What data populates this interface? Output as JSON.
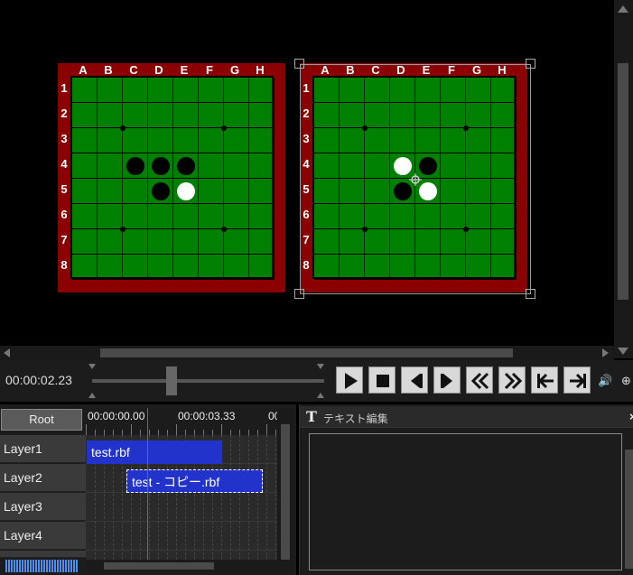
{
  "stage": {
    "column_labels": [
      "A",
      "B",
      "C",
      "D",
      "E",
      "F",
      "G",
      "H"
    ],
    "row_labels": [
      "1",
      "2",
      "3",
      "4",
      "5",
      "6",
      "7",
      "8"
    ],
    "colors": {
      "board_frame": "#8b0000",
      "board_green": "#008000"
    },
    "board_left": {
      "stones": [
        {
          "col": "C",
          "row": "4",
          "color": "black"
        },
        {
          "col": "D",
          "row": "4",
          "color": "black"
        },
        {
          "col": "E",
          "row": "4",
          "color": "black"
        },
        {
          "col": "D",
          "row": "5",
          "color": "black"
        },
        {
          "col": "E",
          "row": "5",
          "color": "white"
        }
      ]
    },
    "board_right": {
      "selected": true,
      "stones": [
        {
          "col": "D",
          "row": "4",
          "color": "white"
        },
        {
          "col": "E",
          "row": "4",
          "color": "black"
        },
        {
          "col": "D",
          "row": "5",
          "color": "black"
        },
        {
          "col": "E",
          "row": "5",
          "color": "white"
        }
      ]
    }
  },
  "transport": {
    "timecode": "00:00:02.23",
    "buttons": [
      "play-icon",
      "stop-icon",
      "step-back-icon",
      "step-forward-icon",
      "rewind-icon",
      "fast-forward-icon",
      "go-to-start-icon",
      "go-to-end-icon"
    ],
    "volume_icon": "🔊",
    "zoom_icon": "⊕"
  },
  "timeline": {
    "root_label": "Root",
    "ruler_labels": [
      "00:00:00.00",
      "00:00:03.33",
      "00:"
    ],
    "layers": [
      "Layer1",
      "Layer2",
      "Layer3",
      "Layer4"
    ],
    "clips": [
      {
        "layer": 0,
        "label": "test.rbf",
        "selected": false
      },
      {
        "layer": 1,
        "label": "test - コピー.rbf",
        "selected": true
      }
    ],
    "clip_color": "#2233cc",
    "playhead_color": "#ee3333"
  },
  "text_panel": {
    "icon": "T",
    "title": "テキスト編集",
    "close": "×"
  }
}
